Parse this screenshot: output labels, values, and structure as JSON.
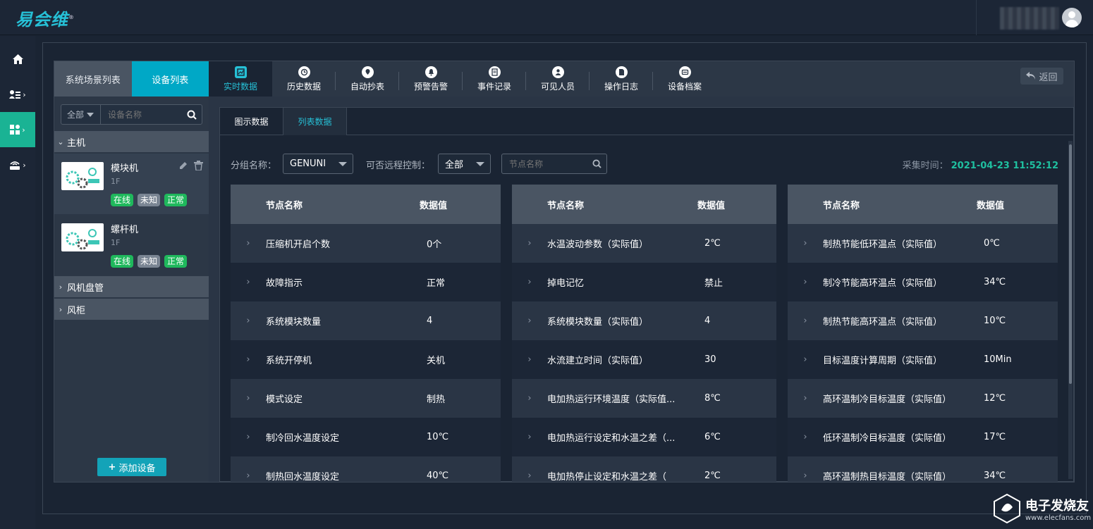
{
  "app": {
    "logo_text": "易会维",
    "logo_mark": "®"
  },
  "sidenav": {
    "items": [
      {
        "icon": "home-icon"
      },
      {
        "icon": "user-list-icon"
      },
      {
        "icon": "apps-icon",
        "active": true
      },
      {
        "icon": "router-icon"
      }
    ]
  },
  "left_panel": {
    "tabs": [
      "系统场景列表",
      "设备列表"
    ],
    "active_tab": 1,
    "filter_value": "全部",
    "search_placeholder": "设备名称",
    "groups": [
      {
        "name": "主机",
        "expanded": true
      },
      {
        "name": "风机盘管",
        "expanded": false
      },
      {
        "name": "风柜",
        "expanded": false
      }
    ],
    "devices": [
      {
        "name": "模块机",
        "floor": "1F",
        "badges": [
          "在线",
          "未知",
          "正常"
        ]
      },
      {
        "name": "螺杆机",
        "floor": "1F",
        "badges": [
          "在线",
          "未知",
          "正常"
        ]
      }
    ],
    "add_button": "添加设备"
  },
  "tabs": [
    {
      "label": "实时数据",
      "icon": "realtime-icon",
      "active": true
    },
    {
      "label": "历史数据",
      "icon": "history-icon"
    },
    {
      "label": "自动抄表",
      "icon": "location-icon"
    },
    {
      "label": "预警告警",
      "icon": "bell-icon"
    },
    {
      "label": "事件记录",
      "icon": "event-icon"
    },
    {
      "label": "可见人员",
      "icon": "person-icon"
    },
    {
      "label": "操作日志",
      "icon": "log-icon"
    },
    {
      "label": "设备档案",
      "icon": "archive-icon"
    }
  ],
  "back_label": "返回",
  "subtabs": [
    "图示数据",
    "列表数据"
  ],
  "active_subtab": 1,
  "filters": {
    "group_label": "分组名称：",
    "group_value": "GENUNI",
    "remote_label": "可否远程控制：",
    "remote_value": "全部",
    "node_placeholder": "节点名称",
    "collect_label": "采集时间：",
    "collect_time": "2021-04-23 11:52:12"
  },
  "table_headers": {
    "name": "节点名称",
    "value": "数据值"
  },
  "tables": [
    {
      "rows": [
        [
          "压缩机开启个数",
          "0个"
        ],
        [
          "故障指示",
          "正常"
        ],
        [
          "系统模块数量",
          "4"
        ],
        [
          "系统开停机",
          "关机"
        ],
        [
          "模式设定",
          "制热"
        ],
        [
          "制冷回水温度设定",
          "10℃"
        ],
        [
          "制热回水温度设定",
          "40℃"
        ]
      ]
    },
    {
      "rows": [
        [
          "水温波动参数（实际值）",
          "2℃"
        ],
        [
          "掉电记忆",
          "禁止"
        ],
        [
          "系统模块数量（实际值）",
          "4"
        ],
        [
          "水流建立时间（实际值）",
          "30"
        ],
        [
          "电加热运行环境温度（实际值...",
          "8℃"
        ],
        [
          "电加热运行设定和水温之差（...",
          "6℃"
        ],
        [
          "电加热停止设定和水温之差（",
          "2℃"
        ]
      ]
    },
    {
      "rows": [
        [
          "制热节能低环温点（实际值）",
          "0℃"
        ],
        [
          "制冷节能高环温点（实际值）",
          "34℃"
        ],
        [
          "制热节能高环温点（实际值）",
          "10℃"
        ],
        [
          "目标温度计算周期（实际值）",
          "10Min"
        ],
        [
          "高环温制冷目标温度（实际值）",
          "12℃"
        ],
        [
          "低环温制冷目标温度（实际值）",
          "17℃"
        ],
        [
          "高环温制热目标温度（实际值）",
          "34℃"
        ]
      ]
    }
  ],
  "watermark": {
    "cn": "电子发烧友",
    "en": "www.elecfans.com"
  }
}
